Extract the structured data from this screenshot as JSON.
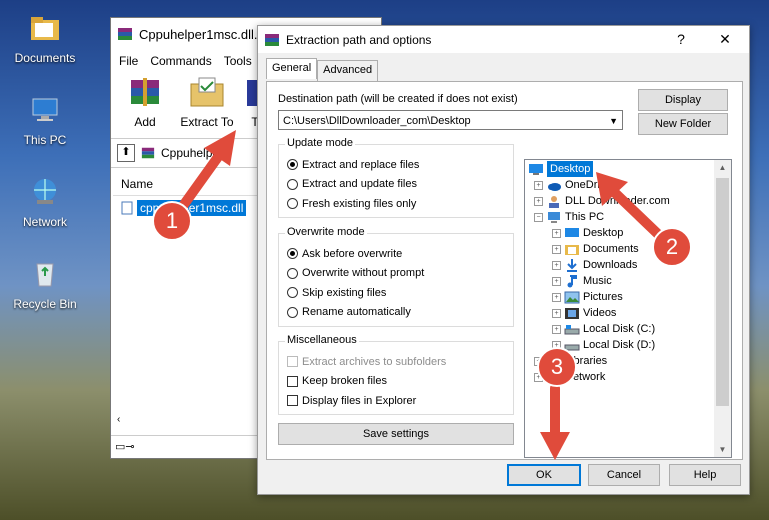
{
  "desktop": {
    "icons": [
      {
        "label": "Documents",
        "icon": "folder-documents-icon"
      },
      {
        "label": "This PC",
        "icon": "computer-icon"
      },
      {
        "label": "Network",
        "icon": "network-icon"
      },
      {
        "label": "Recycle Bin",
        "icon": "recycle-bin-icon"
      }
    ]
  },
  "winrar": {
    "title": "Cppuhelper1msc.dll.",
    "menu": [
      "File",
      "Commands",
      "Tools"
    ],
    "tools": [
      {
        "label": "Add"
      },
      {
        "label": "Extract To"
      },
      {
        "label": "T"
      }
    ],
    "address": "Cppuhelpe",
    "column_name": "Name",
    "file": "cppuhelper1msc.dll"
  },
  "dialog": {
    "title": "Extraction path and options",
    "help": "?",
    "close": "✕",
    "tabs": [
      "General",
      "Advanced"
    ],
    "dest_label": "Destination path (will be created if does not exist)",
    "dest_value": "C:\\Users\\DllDownloader_com\\Desktop",
    "display_btn": "Display",
    "new_folder_btn": "New Folder",
    "update_mode": {
      "title": "Update mode",
      "options": [
        "Extract and replace files",
        "Extract and update files",
        "Fresh existing files only"
      ],
      "selected": 0
    },
    "overwrite_mode": {
      "title": "Overwrite mode",
      "options": [
        "Ask before overwrite",
        "Overwrite without prompt",
        "Skip existing files",
        "Rename automatically"
      ],
      "selected": 0
    },
    "misc": {
      "title": "Miscellaneous",
      "options": [
        "Extract archives to subfolders",
        "Keep broken files",
        "Display files in Explorer"
      ]
    },
    "save_settings": "Save settings",
    "tree": [
      {
        "label": "Desktop",
        "level": 0,
        "selected": true
      },
      {
        "label": "OneDrive",
        "level": 1
      },
      {
        "label": "DLL Downloader.com",
        "level": 1
      },
      {
        "label": "This PC",
        "level": 1,
        "expanded": true
      },
      {
        "label": "Desktop",
        "level": 2
      },
      {
        "label": "Documents",
        "level": 2
      },
      {
        "label": "Downloads",
        "level": 2
      },
      {
        "label": "Music",
        "level": 2
      },
      {
        "label": "Pictures",
        "level": 2
      },
      {
        "label": "Videos",
        "level": 2
      },
      {
        "label": "Local Disk (C:)",
        "level": 2
      },
      {
        "label": "Local Disk (D:)",
        "level": 2
      },
      {
        "label": "Libraries",
        "level": 1
      },
      {
        "label": "Network",
        "level": 1
      }
    ],
    "ok": "OK",
    "cancel": "Cancel",
    "help_btn": "Help"
  },
  "annotations": {
    "badges": [
      "1",
      "2",
      "3"
    ],
    "color": "#e04b3b"
  }
}
